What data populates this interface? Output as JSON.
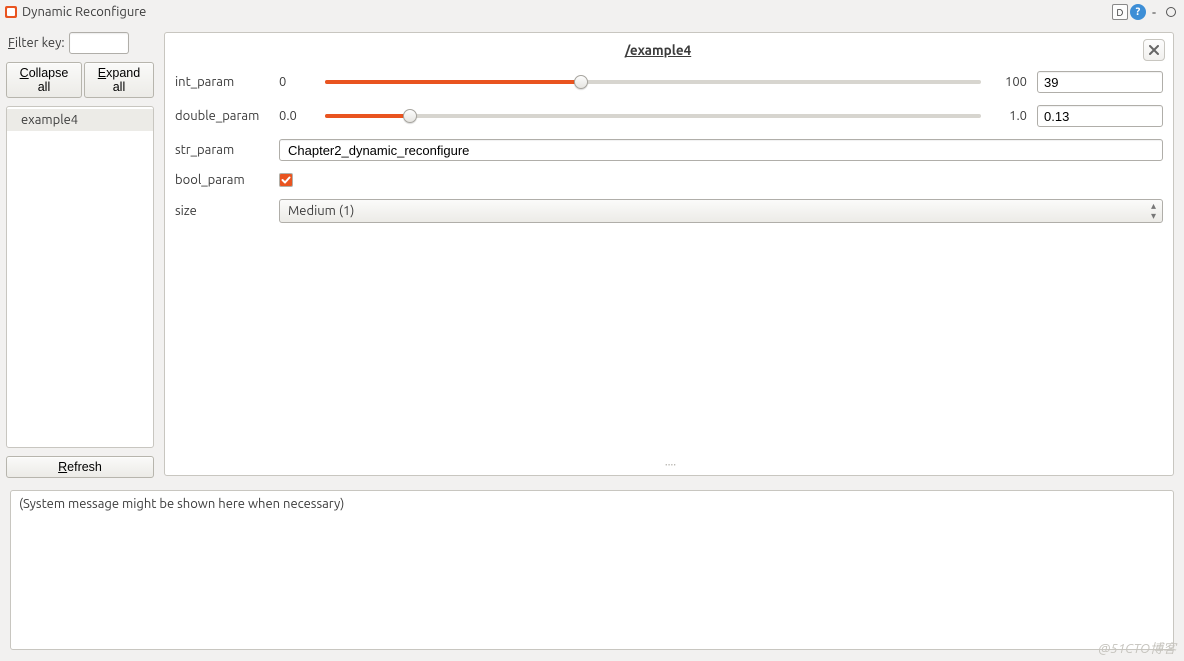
{
  "title": "Dynamic Reconfigure",
  "titlebar": {
    "d_letter": "D",
    "help": "?"
  },
  "sidebar": {
    "filter_label_pre": "F",
    "filter_label_rest": "ilter key:",
    "filter_value": "",
    "collapse_pre": "C",
    "collapse_rest": "ollapse all",
    "expand_pre": "E",
    "expand_rest": "xpand all",
    "tree_item": "example4",
    "refresh_pre": "R",
    "refresh_rest": "efresh"
  },
  "panel": {
    "title": "/example4",
    "params": {
      "int_param": {
        "label": "int_param",
        "min": "0",
        "max": "100",
        "value": "39",
        "fill_pct": 39,
        "thumb_pct": 39
      },
      "double_param": {
        "label": "double_param",
        "min": "0.0",
        "max": "1.0",
        "value": "0.13",
        "fill_pct": 13,
        "thumb_pct": 13
      },
      "str_param": {
        "label": "str_param",
        "value": "Chapter2_dynamic_reconfigure"
      },
      "bool_param": {
        "label": "bool_param",
        "checked": true
      },
      "size": {
        "label": "size",
        "value": "Medium (1)"
      }
    },
    "drag_handle": "᠁"
  },
  "message": "(System message might be shown here when necessary)",
  "watermark": "@51CTO博客"
}
